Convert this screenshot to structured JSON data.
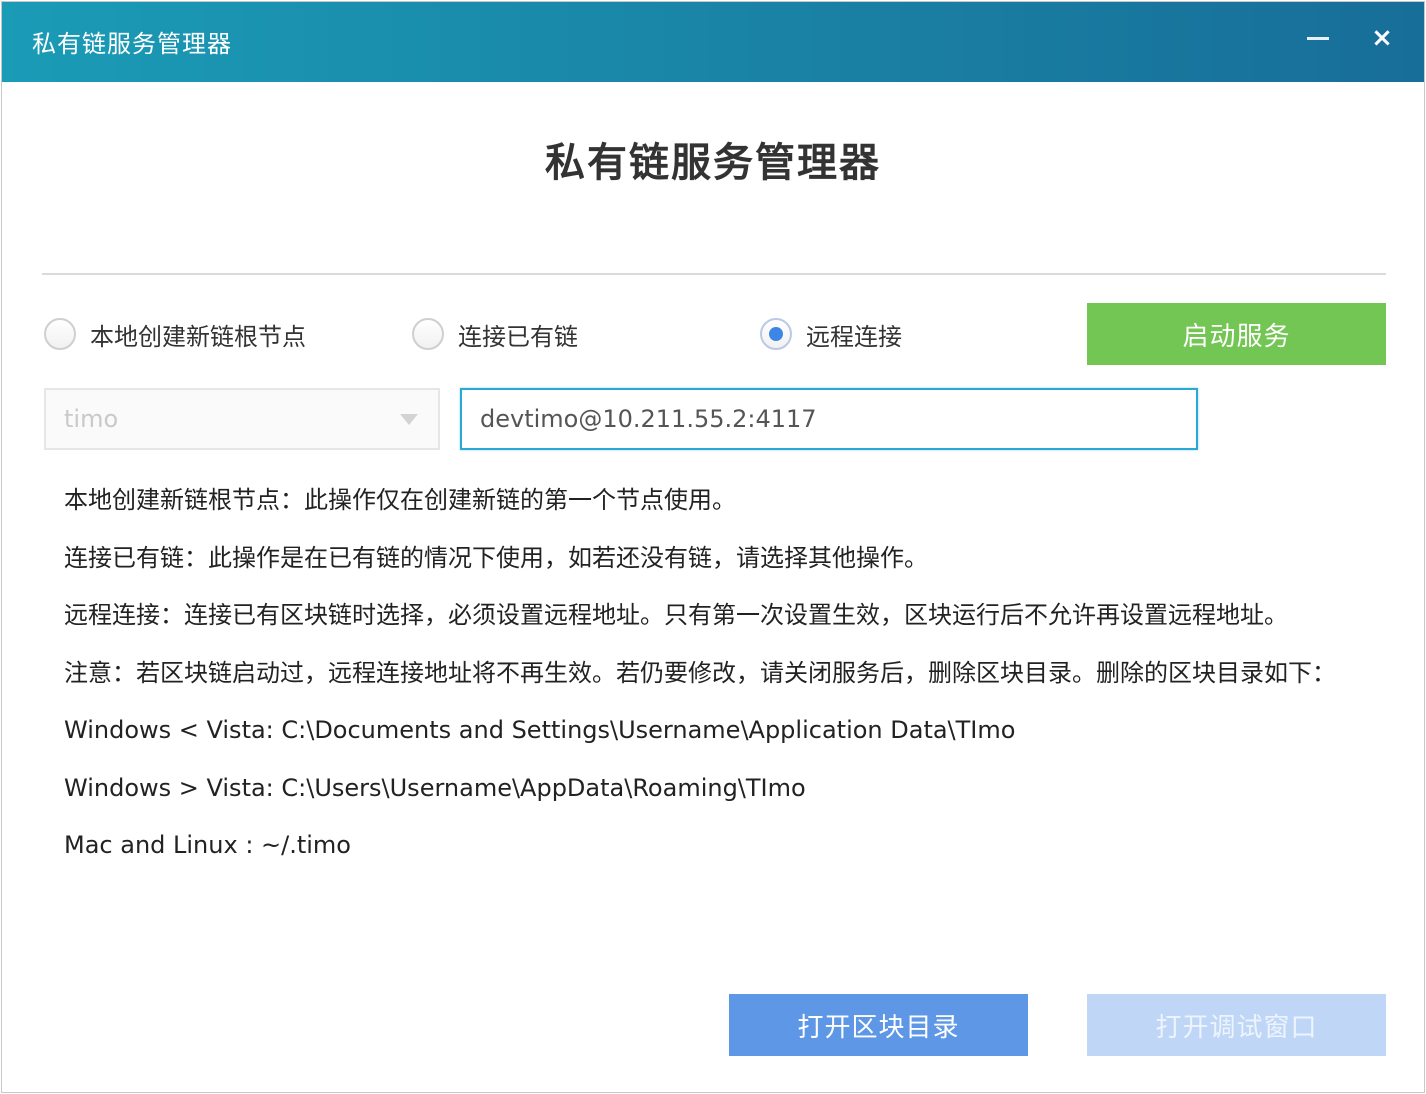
{
  "window": {
    "title": "私有链服务管理器",
    "minimize_label": "",
    "close_label": "×"
  },
  "main": {
    "heading": "私有链服务管理器"
  },
  "options": {
    "local_root": {
      "label": "本地创建新链根节点",
      "checked": false
    },
    "connect_existing": {
      "label": "连接已有链",
      "checked": false
    },
    "remote": {
      "label": "远程连接",
      "checked": true
    }
  },
  "buttons": {
    "start": "启动服务",
    "open_dir": "打开区块目录",
    "open_debug": "打开调试窗口"
  },
  "select": {
    "value": "timo"
  },
  "remote_address": {
    "value": "devtimo@10.211.55.2:4117"
  },
  "description": {
    "line1": "本地创建新链根节点：此操作仅在创建新链的第一个节点使用。",
    "line2": "连接已有链：此操作是在已有链的情况下使用，如若还没有链，请选择其他操作。",
    "line3": "远程连接：连接已有区块链时选择，必须设置远程地址。只有第一次设置生效，区块运行后不允许再设置远程地址。",
    "line4": "注意：若区块链启动过，远程连接地址将不再生效。若仍要修改，请关闭服务后，删除区块目录。删除的区块目录如下：",
    "line5": "Windows < Vista: C:\\Documents and Settings\\Username\\Application Data\\TImo",
    "line6": "Windows > Vista: C:\\Users\\Username\\AppData\\Roaming\\TImo",
    "line7": "Mac and Linux : ~/.timo"
  },
  "colors": {
    "titlebar": "#1a80a3",
    "start_button": "#73c653",
    "primary_button": "#5e97e6",
    "disabled_button": "#bfd6f6",
    "radio_checked": "#3b86e6",
    "input_focus": "#2aa9d6"
  }
}
